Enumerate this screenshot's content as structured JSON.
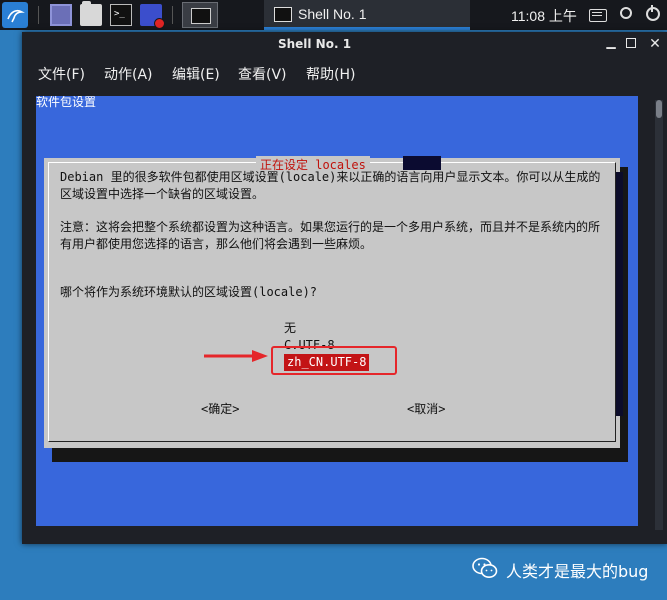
{
  "taskbar": {
    "icons": [
      "kali-menu-icon",
      "desktop-icon",
      "file-manager-icon",
      "terminal-icon",
      "screen-recorder-icon",
      "window-icon"
    ],
    "task_label": "Shell No. 1",
    "clock": "11:08 上午",
    "tray_icons": [
      "keyboard-icon",
      "notification-bell-icon",
      "power-icon"
    ]
  },
  "window": {
    "title": "Shell No. 1",
    "buttons": [
      "minimize",
      "maximize",
      "close"
    ],
    "menu": [
      "文件(F)",
      "动作(A)",
      "编辑(E)",
      "查看(V)",
      "帮助(H)"
    ]
  },
  "terminal": {
    "screen_title": "软件包设置",
    "dialog": {
      "title": "正在设定 locales",
      "paragraph1": "Debian 里的很多软件包都使用区域设置(locale)来以正确的语言向用户显示文本。你可以从生成的区域设置中选择一个缺省的区域设置。",
      "paragraph2": "注意：这将会把整个系统都设置为这种语言。如果您运行的是一个多用户系统，而且并不是系统内的所有用户都使用您选择的语言，那么他们将会遇到一些麻烦。",
      "question": "哪个将作为系统环境默认的区域设置(locale)?",
      "options": [
        "无",
        "C.UTF-8",
        "zh_CN.UTF-8"
      ],
      "selected_option": "zh_CN.UTF-8",
      "ok_label": "<确定>",
      "cancel_label": "<取消>"
    }
  },
  "annotation": {
    "color": "#e5262a",
    "target": "zh_CN.UTF-8"
  },
  "watermark": {
    "text": "人类才是最大的bug",
    "icon": "wechat-icon"
  },
  "colors": {
    "taskbar": "#16181d",
    "desktop": "#2d7dbd",
    "terminal_bg": "#3867dc",
    "dialog_bg": "#c7c7c7",
    "dialog_title": "#c0120c",
    "selection": "#c31416"
  }
}
